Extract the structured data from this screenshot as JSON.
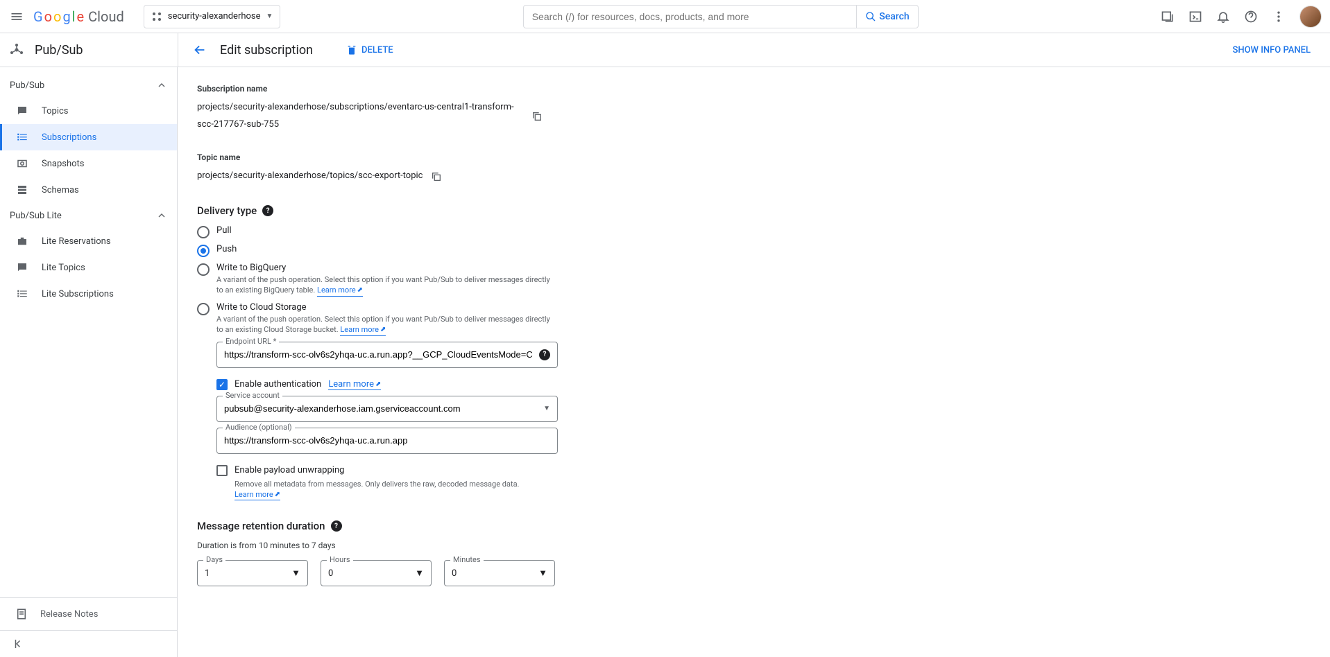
{
  "header": {
    "logo_cloud": "Cloud",
    "project_name": "security-alexanderhose",
    "search_placeholder": "Search (/) for resources, docs, products, and more",
    "search_btn": "Search"
  },
  "product": {
    "name": "Pub/Sub"
  },
  "pagebar": {
    "title": "Edit subscription",
    "delete": "DELETE",
    "show_info": "SHOW INFO PANEL"
  },
  "sidebar": {
    "section1": "Pub/Sub",
    "items1": {
      "topics": "Topics",
      "subscriptions": "Subscriptions",
      "snapshots": "Snapshots",
      "schemas": "Schemas"
    },
    "section2": "Pub/Sub Lite",
    "items2": {
      "reservations": "Lite Reservations",
      "topics": "Lite Topics",
      "subscriptions": "Lite Subscriptions"
    },
    "release_notes": "Release Notes"
  },
  "subscription": {
    "name_label": "Subscription name",
    "name_value": "projects/security-alexanderhose/subscriptions/eventarc-us-central1-transform-scc-217767-sub-755",
    "topic_label": "Topic name",
    "topic_value": "projects/security-alexanderhose/topics/scc-export-topic"
  },
  "delivery": {
    "heading": "Delivery type",
    "pull": "Pull",
    "push": "Push",
    "bigquery": "Write to BigQuery",
    "bigquery_desc": "A variant of the push operation. Select this option if you want Pub/Sub to deliver messages directly to an existing BigQuery table.",
    "cloudstorage": "Write to Cloud Storage",
    "cloudstorage_desc": "A variant of the push operation. Select this option if you want Pub/Sub to deliver messages directly to an existing Cloud Storage bucket.",
    "learn_more": "Learn more",
    "endpoint_label": "Endpoint URL *",
    "endpoint_value": "https://transform-scc-olv6s2yhqa-uc.a.run.app?__GCP_CloudEventsMode=C",
    "enable_auth": "Enable authentication",
    "service_account_label": "Service account",
    "service_account_value": "pubsub@security-alexanderhose.iam.gserviceaccount.com",
    "audience_label": "Audience (optional)",
    "audience_value": "https://transform-scc-olv6s2yhqa-uc.a.run.app",
    "payload_unwrap": "Enable payload unwrapping",
    "payload_unwrap_desc": "Remove all metadata from messages. Only delivers the raw, decoded message data."
  },
  "retention": {
    "heading": "Message retention duration",
    "hint": "Duration is from 10 minutes to 7 days",
    "days_label": "Days",
    "days_value": "1",
    "hours_label": "Hours",
    "hours_value": "0",
    "minutes_label": "Minutes",
    "minutes_value": "0"
  }
}
